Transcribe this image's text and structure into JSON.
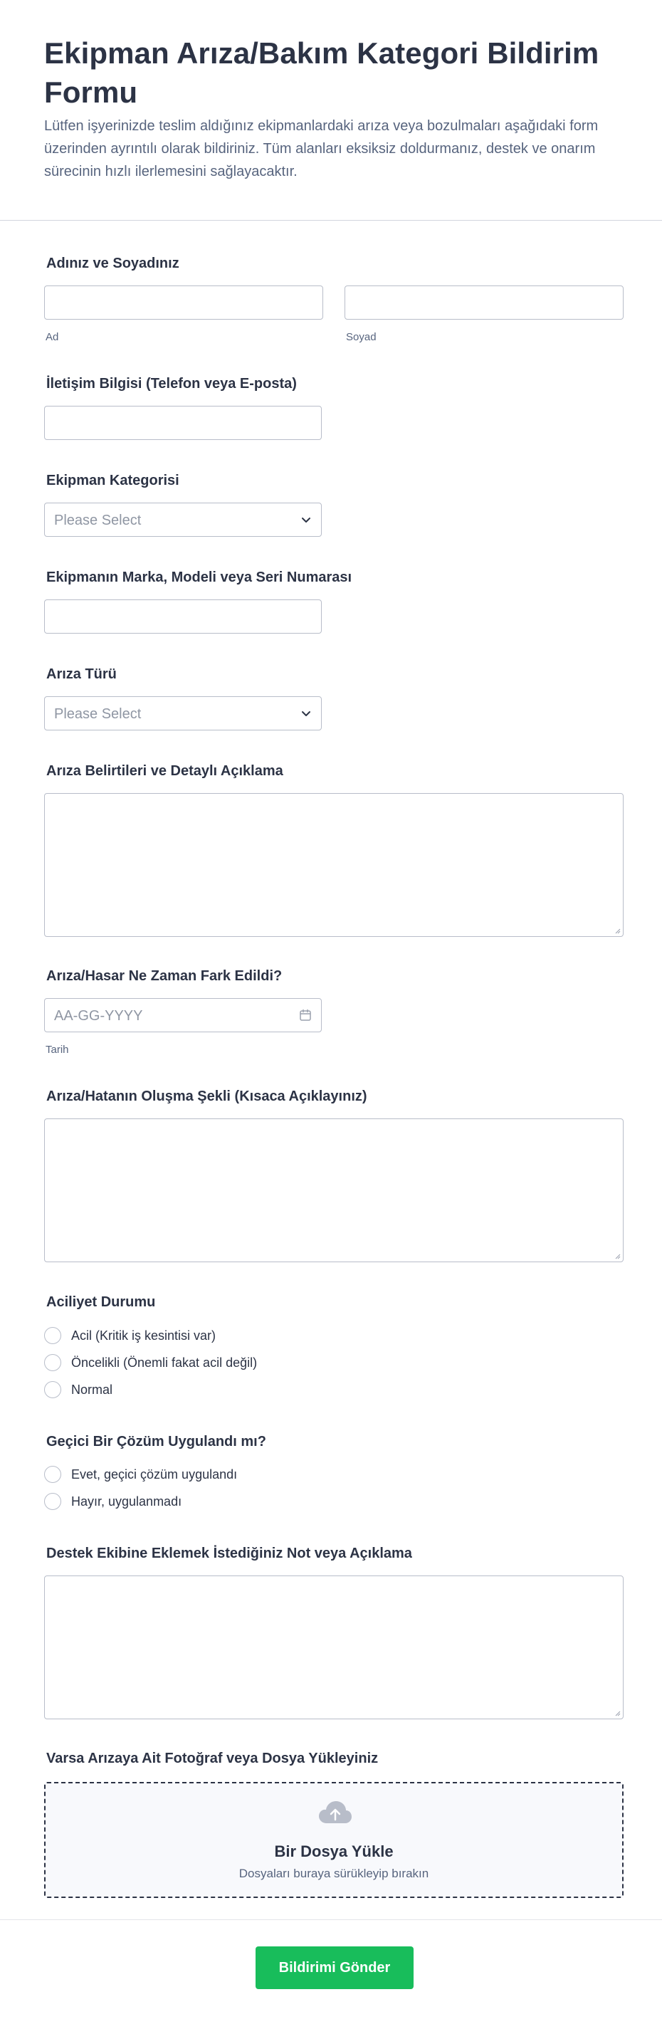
{
  "header": {
    "title": "Ekipman Arıza/Bakım Kategori Bildirim Formu",
    "description": "Lütfen işyerinizde teslim aldığınız ekipmanlardaki arıza veya bozulmaları aşağıdaki form üzerinden ayrıntılı olarak bildiriniz. Tüm alanları eksiksiz doldurmanız, destek ve onarım sürecinin hızlı ilerlemesini sağlayacaktır."
  },
  "fields": {
    "name": {
      "label": "Adınız ve Soyadınız",
      "first_sublabel": "Ad",
      "last_sublabel": "Soyad",
      "first_value": "",
      "last_value": ""
    },
    "contact": {
      "label": "İletişim Bilgisi (Telefon veya E-posta)",
      "value": ""
    },
    "category": {
      "label": "Ekipman Kategorisi",
      "selected": "Please Select"
    },
    "brand_model": {
      "label": "Ekipmanın Marka, Modeli veya Seri Numarası",
      "value": ""
    },
    "fault_type": {
      "label": "Arıza Türü",
      "selected": "Please Select"
    },
    "symptoms": {
      "label": "Arıza Belirtileri ve Detaylı Açıklama",
      "value": ""
    },
    "noticed_date": {
      "label": "Arıza/Hasar Ne Zaman Fark Edildi?",
      "placeholder": "AA-GG-YYYY",
      "sublabel": "Tarih"
    },
    "occurrence": {
      "label": "Arıza/Hatanın Oluşma Şekli (Kısaca Açıklayınız)",
      "value": ""
    },
    "urgency": {
      "label": "Aciliyet Durumu",
      "options": [
        "Acil (Kritik iş kesintisi var)",
        "Öncelikli (Önemli fakat acil değil)",
        "Normal"
      ]
    },
    "temp_fix": {
      "label": "Geçici Bir Çözüm Uygulandı mı?",
      "options": [
        "Evet, geçici çözüm uygulandı",
        "Hayır, uygulanmadı"
      ]
    },
    "notes": {
      "label": "Destek Ekibine Eklemek İstediğiniz Not veya Açıklama",
      "value": ""
    },
    "upload": {
      "label": "Varsa Arızaya Ait Fotoğraf veya Dosya Yükleyiniz",
      "title": "Bir Dosya Yükle",
      "subtitle": "Dosyaları buraya sürükleyip bırakın"
    }
  },
  "submit": {
    "label": "Bildirimi Gönder"
  },
  "icons": {
    "select": "chevron-down-icon",
    "date": "calendar-icon",
    "upload": "cloud-upload-icon"
  },
  "colors": {
    "submit": "#18bd5b",
    "text": "#2c3345",
    "muted": "#57647e",
    "border": "#b8bdc9"
  }
}
